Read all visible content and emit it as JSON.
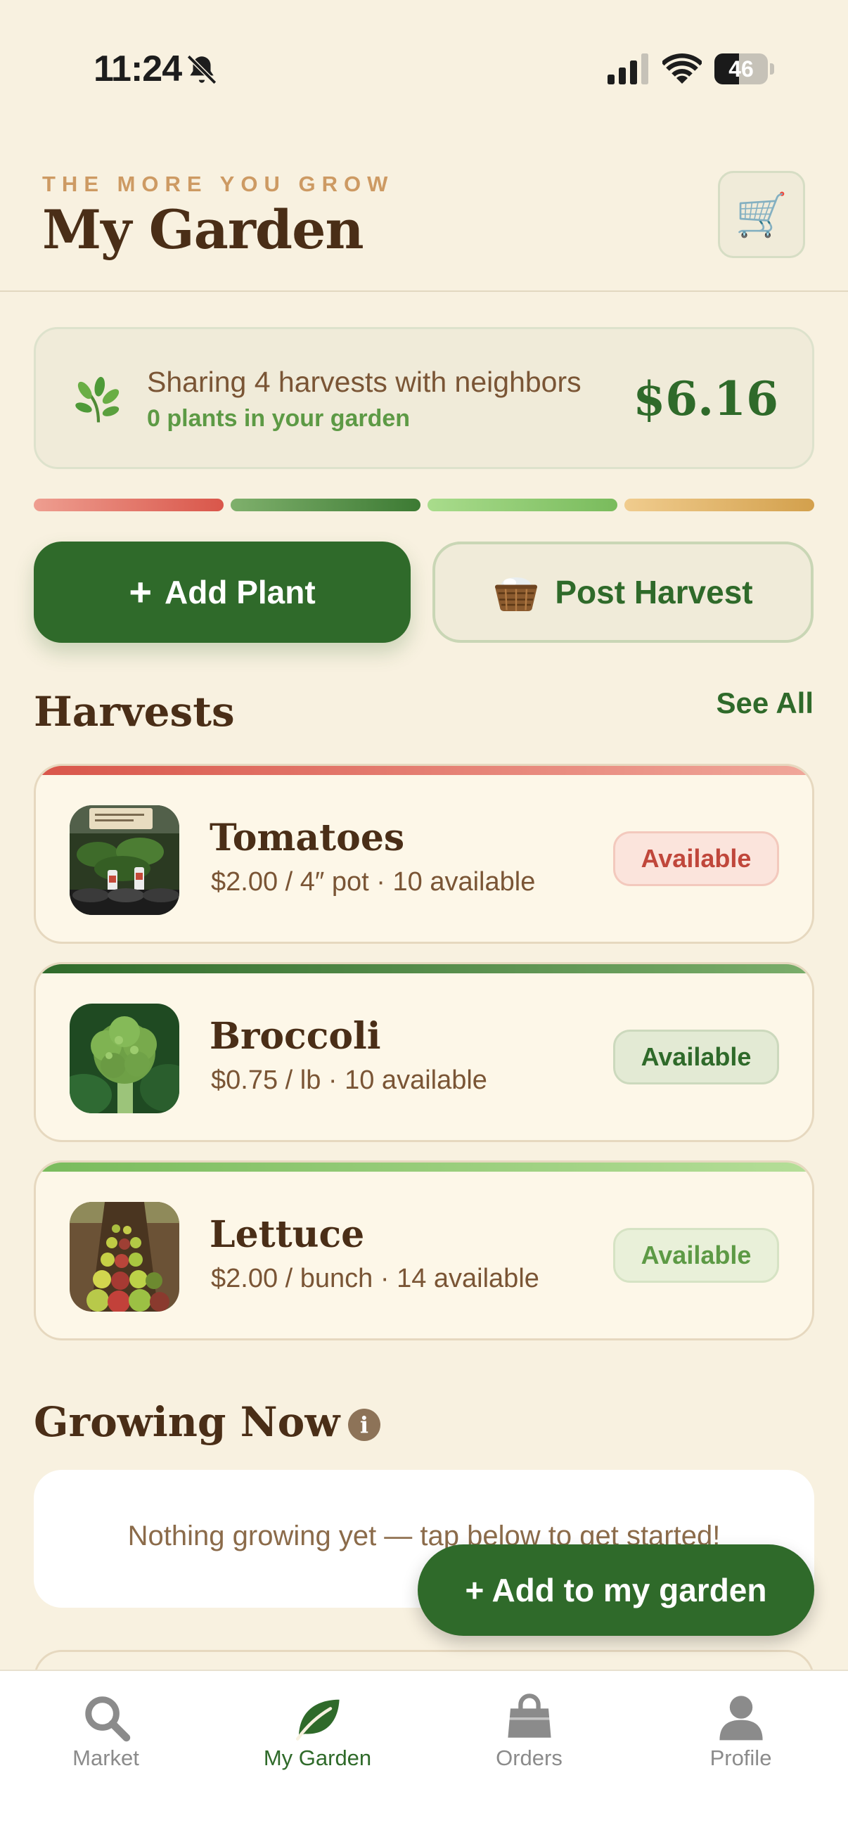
{
  "status_bar": {
    "time": "11:24",
    "battery": "46"
  },
  "header": {
    "eyebrow": "THE MORE YOU GROW",
    "title": "My Garden"
  },
  "summary": {
    "line1": "Sharing 4 harvests with neighbors",
    "line2": "0 plants in your garden",
    "amount": "$6.16"
  },
  "stripe_colors": [
    "#d9564a",
    "#3c7a33",
    "#79bb5c",
    "#d3a04c"
  ],
  "actions": {
    "add_plant": "Add Plant",
    "post_harvest": "Post Harvest"
  },
  "harvests": {
    "title": "Harvests",
    "see_all": "See All",
    "items": [
      {
        "name": "Tomatoes",
        "meta": "$2.00 / 4″ pot · 10 available",
        "status": "Available",
        "accent": "#d9564a"
      },
      {
        "name": "Broccoli",
        "meta": "$0.75 / lb · 10 available",
        "status": "Available",
        "accent": "#3c7a33"
      },
      {
        "name": "Lettuce",
        "meta": "$2.00 / bunch · 14 available",
        "status": "Available",
        "accent": "#79bb5c"
      }
    ]
  },
  "growing_now": {
    "title": "Growing Now",
    "empty_text": "Nothing growing yet — tap below to get started!",
    "fab_label": "+ Add to my garden"
  },
  "tabs": [
    {
      "label": "Market",
      "icon": "search-icon"
    },
    {
      "label": "My Garden",
      "icon": "leaf-icon",
      "active": true
    },
    {
      "label": "Orders",
      "icon": "bag-icon"
    },
    {
      "label": "Profile",
      "icon": "person-icon"
    }
  ]
}
